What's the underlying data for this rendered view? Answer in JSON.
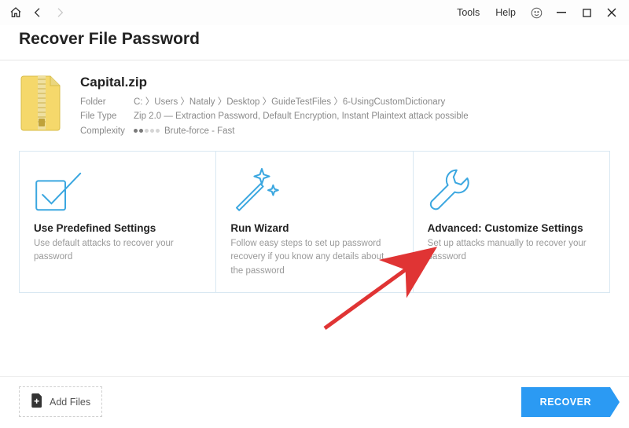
{
  "titlebar": {
    "menu": {
      "tools": "Tools",
      "help": "Help"
    }
  },
  "header": {
    "title": "Recover File Password"
  },
  "file": {
    "name": "Capital.zip",
    "meta": {
      "folder_label": "Folder",
      "folder_value": "C: 〉Users 〉Nataly 〉Desktop 〉GuideTestFiles 〉6-UsingCustomDictionary",
      "type_label": "File Type",
      "type_value": "Zip 2.0 — Extraction Password, Default Encryption, Instant Plaintext attack possible",
      "complexity_label": "Complexity",
      "complexity_value": "Brute-force - Fast",
      "complexity_level": 2
    }
  },
  "cards": {
    "predefined": {
      "title": "Use Predefined Settings",
      "desc": "Use default attacks to recover your password"
    },
    "wizard": {
      "title": "Run Wizard",
      "desc": "Follow easy steps to set up password recovery if you know any details about the password"
    },
    "advanced": {
      "title": "Advanced: Customize Settings",
      "desc": "Set up attacks manually to recover your password"
    }
  },
  "footer": {
    "add_files": "Add Files",
    "recover": "RECOVER"
  }
}
